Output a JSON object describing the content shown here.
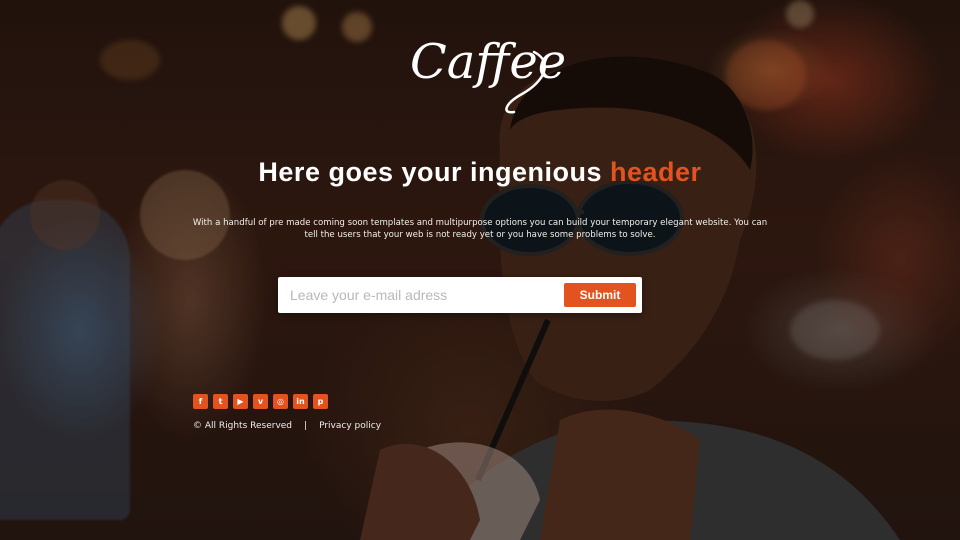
{
  "brand": {
    "logo_text": "Caffee"
  },
  "hero": {
    "headline_main": "Here goes your ingenious",
    "headline_accent": "header",
    "description": "With a handful of pre made coming soon templates and  multipurpose  options you can build your temporary elegant website. You can tell the users that your web is not ready yet or you have some problems to solve."
  },
  "signup": {
    "email_placeholder": "Leave your e-mail adress",
    "email_value": "",
    "submit_label": "Submit"
  },
  "social": [
    {
      "name": "facebook-icon",
      "glyph": "f"
    },
    {
      "name": "twitter-icon",
      "glyph": "t"
    },
    {
      "name": "youtube-icon",
      "glyph": "▶"
    },
    {
      "name": "vimeo-icon",
      "glyph": "v"
    },
    {
      "name": "instagram-icon",
      "glyph": "◎"
    },
    {
      "name": "linkedin-icon",
      "glyph": "in"
    },
    {
      "name": "pinterest-icon",
      "glyph": "p"
    }
  ],
  "footer": {
    "copyright": "© All Rights Reserved",
    "separator": "|",
    "privacy_label": "Privacy policy"
  },
  "colors": {
    "accent": "#e2531f",
    "text": "#ffffff",
    "input_bg": "#ffffff"
  }
}
